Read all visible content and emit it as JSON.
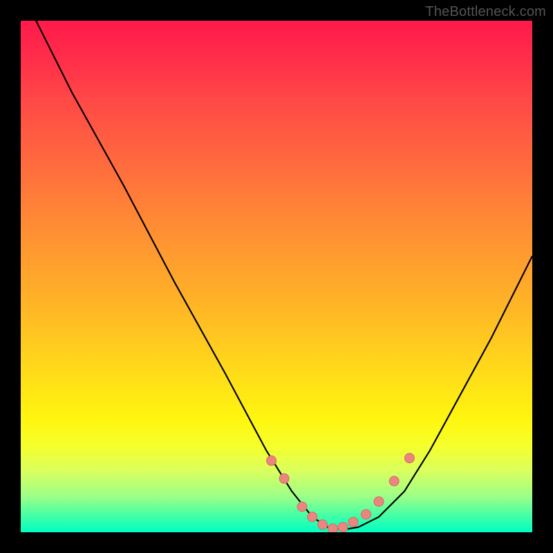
{
  "watermark": "TheBottleneck.com",
  "chart_data": {
    "type": "line",
    "title": "",
    "xlabel": "",
    "ylabel": "",
    "xlim": [
      0,
      100
    ],
    "ylim": [
      0,
      100
    ],
    "series": [
      {
        "name": "bottleneck-curve",
        "x": [
          3,
          10,
          20,
          30,
          40,
          48,
          53,
          57,
          60,
          63,
          66,
          70,
          75,
          80,
          86,
          92,
          100
        ],
        "values": [
          100,
          86,
          68,
          49,
          31,
          16,
          8,
          3,
          1,
          0.5,
          1,
          3,
          8,
          16,
          27,
          38,
          54
        ]
      }
    ],
    "markers": {
      "name": "highlight-dots",
      "x": [
        49,
        51.5,
        55,
        57,
        59,
        61,
        63,
        65,
        67.5,
        70,
        73,
        76
      ],
      "values": [
        14,
        10.5,
        5,
        3,
        1.5,
        0.7,
        1,
        2,
        3.5,
        6,
        10,
        14.5
      ]
    },
    "colors": {
      "curve": "#000000",
      "marker_fill": "#e98680",
      "marker_stroke": "#d86a63"
    }
  }
}
